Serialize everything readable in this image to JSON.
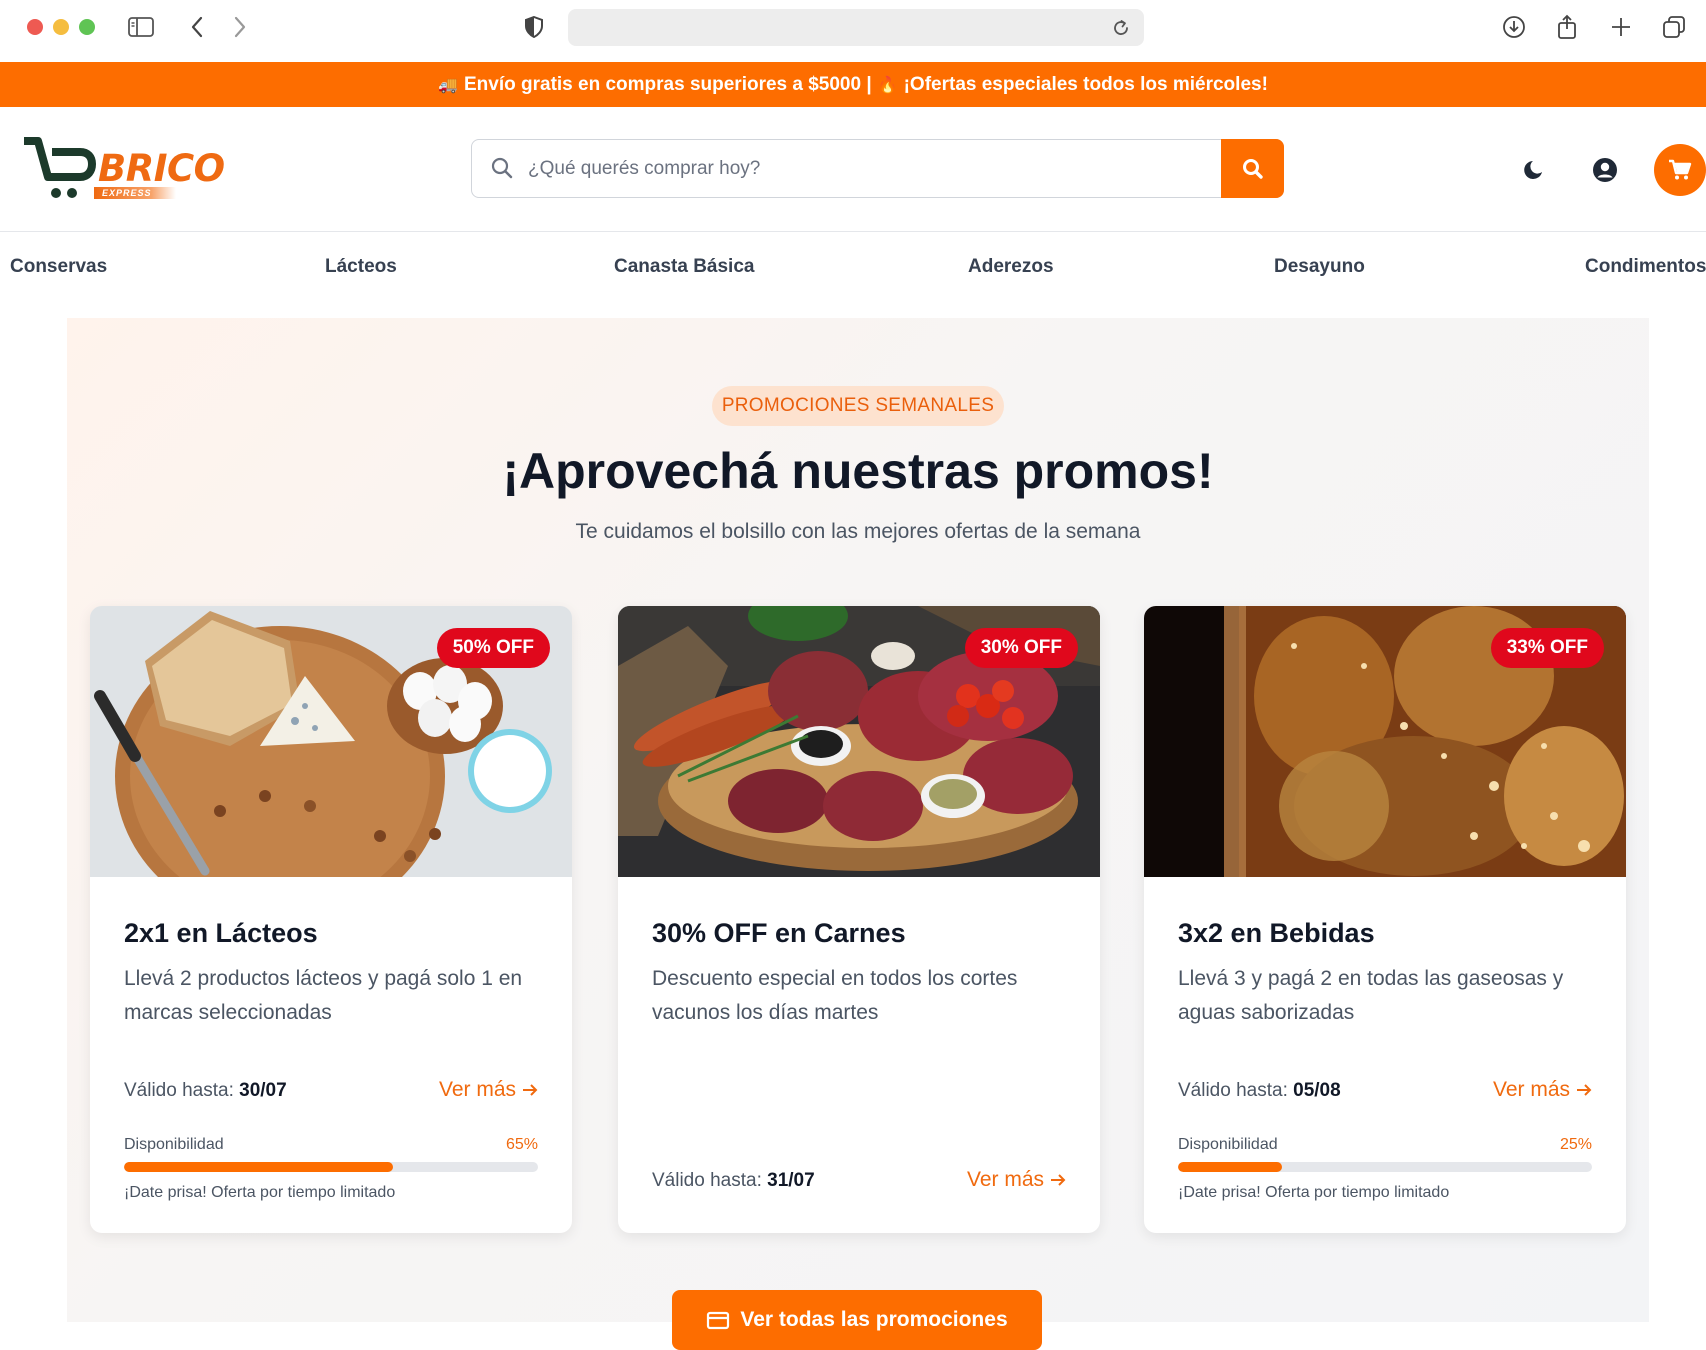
{
  "browser": {
    "url": ""
  },
  "announcement": {
    "truck_icon": "🚚",
    "part1": "Envío gratis en compras superiores a $5000 |",
    "fire_icon": "🔥",
    "part2": "¡Ofertas especiales todos los miércoles!"
  },
  "header": {
    "logo_text": "BRICO",
    "logo_sub": "EXPRESS",
    "search_placeholder": "¿Qué querés comprar hoy?"
  },
  "categories": [
    "Conservas",
    "Lácteos",
    "Canasta Básica",
    "Aderezos",
    "Desayuno",
    "Condimentos"
  ],
  "promo": {
    "pill": "PROMOCIONES SEMANALES",
    "title": "¡Aprovechá nuestras promos!",
    "subtitle": "Te cuidamos el bolsillo con las mejores ofertas de la semana",
    "cards": [
      {
        "badge": "50% OFF",
        "title": "2x1 en Lácteos",
        "desc": "Llevá 2 productos lácteos y pagá solo 1 en marcas seleccionadas",
        "valid_label": "Válido hasta:",
        "valid_date": "30/07",
        "link": "Ver más",
        "avail_label": "Disponibilidad",
        "avail_pct": "65%",
        "avail_value": 0.65,
        "hurry": "¡Date prisa! Oferta por tiempo limitado"
      },
      {
        "badge": "30% OFF",
        "title": "30% OFF en Carnes",
        "desc": "Descuento especial en todos los cortes vacunos los días martes",
        "valid_label": "Válido hasta:",
        "valid_date": "31/07",
        "link": "Ver más"
      },
      {
        "badge": "33% OFF",
        "title": "3x2 en Bebidas",
        "desc": "Llevá 3 y pagá 2 en todas las gaseosas y aguas saborizadas",
        "valid_label": "Válido hasta:",
        "valid_date": "05/08",
        "link": "Ver más",
        "avail_label": "Disponibilidad",
        "avail_pct": "25%",
        "avail_value": 0.25,
        "hurry": "¡Date prisa! Oferta por tiempo limitado"
      }
    ],
    "cta": "Ver todas las promociones"
  },
  "colors": {
    "brand_orange": "#fd6d00",
    "badge_red": "#e0081c",
    "logo_green": "#1c3a2b"
  }
}
